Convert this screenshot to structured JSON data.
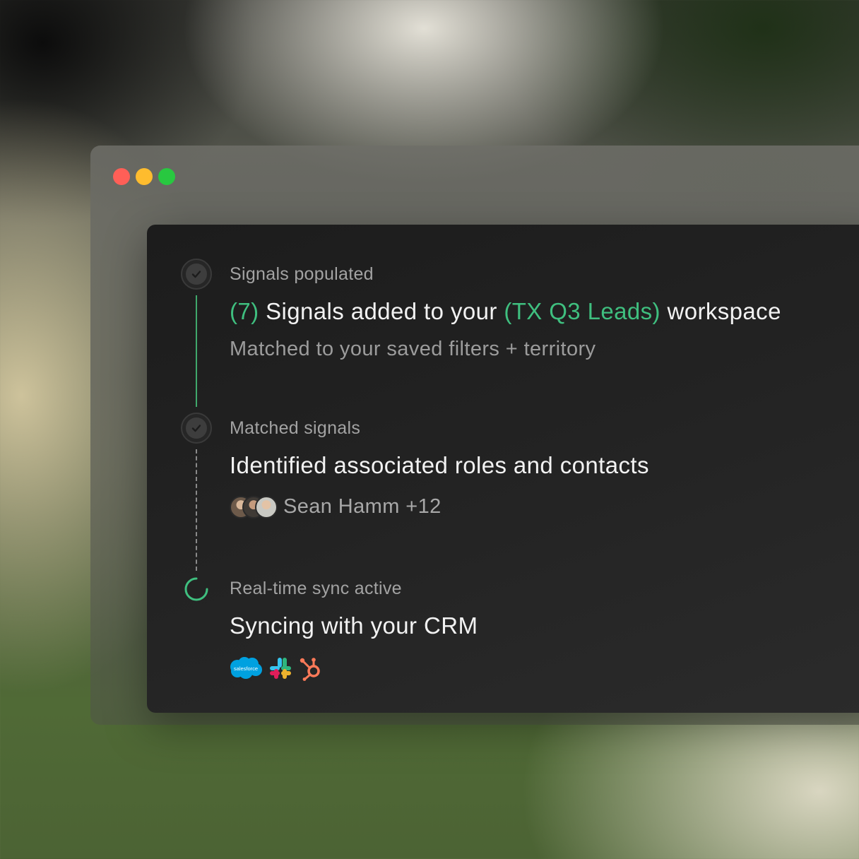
{
  "window": {
    "controls": [
      "close",
      "minimize",
      "maximize"
    ]
  },
  "steps": [
    {
      "label": "Signals populated",
      "headline_count": "(7)",
      "headline_mid": " Signals added to your ",
      "headline_workspace": "(TX Q3 Leads)",
      "headline_end": " workspace",
      "subtext": "Matched to your saved filters + territory",
      "status": "complete"
    },
    {
      "label": "Matched signals",
      "headline": "Identified associated roles and contacts",
      "contacts_text": "Sean Hamm +12",
      "status": "complete"
    },
    {
      "label": "Real-time sync active",
      "headline": "Syncing with your CRM",
      "status": "in-progress",
      "integrations": [
        {
          "name": "salesforce-icon",
          "text": "salesforce"
        },
        {
          "name": "slack-icon"
        },
        {
          "name": "hubspot-icon"
        }
      ]
    }
  ],
  "colors": {
    "accent": "#3fbf7f",
    "timeline_solid": "#3fa86b",
    "salesforce": "#00a1e0",
    "hubspot": "#ff7a59"
  }
}
